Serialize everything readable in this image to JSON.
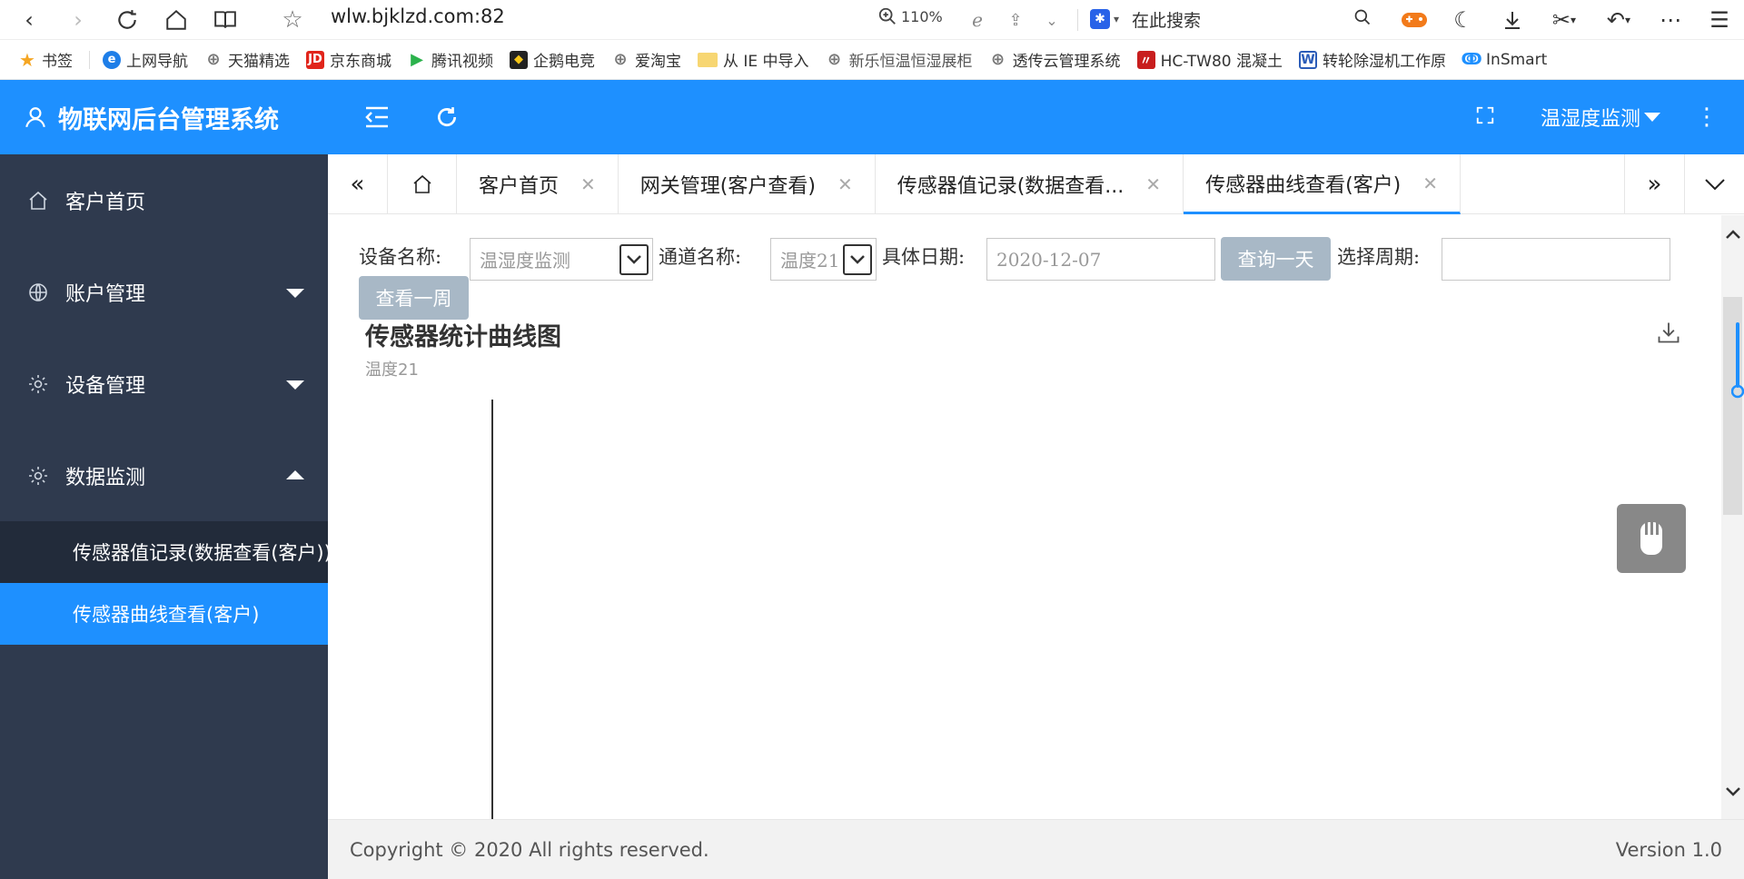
{
  "browser": {
    "url": "wlw.bjklzd.com:82",
    "zoom": "110%",
    "search_placeholder": "在此搜索"
  },
  "bookmarks": [
    {
      "label": "书签",
      "icon": "star-icon"
    },
    {
      "label": "上网导航",
      "icon": "ie-icon"
    },
    {
      "label": "天猫精选",
      "icon": "globe-icon"
    },
    {
      "label": "京东商城",
      "icon": "jd-icon"
    },
    {
      "label": "腾讯视频",
      "icon": "video-icon"
    },
    {
      "label": "企鹅电竞",
      "icon": "penguin-icon"
    },
    {
      "label": "爱淘宝",
      "icon": "globe-icon"
    },
    {
      "label": "从 IE 中导入",
      "icon": "folder-icon"
    },
    {
      "label": "新乐恒温恒湿展柜",
      "icon": "globe-icon"
    },
    {
      "label": "透传云管理系统",
      "icon": "globe-icon"
    },
    {
      "label": "HC-TW80 混凝土",
      "icon": "brand-icon"
    },
    {
      "label": "转轮除湿机工作原",
      "icon": "word-icon"
    },
    {
      "label": "InSmart",
      "icon": "insmart-icon"
    }
  ],
  "header": {
    "brand": "物联网后台管理系统",
    "user_menu": "温湿度监测"
  },
  "sidebar": {
    "items": [
      {
        "label": "客户首页"
      },
      {
        "label": "账户管理"
      },
      {
        "label": "设备管理"
      },
      {
        "label": "数据监测"
      }
    ],
    "sub_items": [
      {
        "label": "传感器值记录(数据查看(客户))"
      },
      {
        "label": "传感器曲线查看(客户)"
      }
    ]
  },
  "tabs": [
    {
      "label": "客户首页"
    },
    {
      "label": "网关管理(客户查看)"
    },
    {
      "label": "传感器值记录(数据查看..."
    },
    {
      "label": "传感器曲线查看(客户)"
    }
  ],
  "form": {
    "device_label": "设备名称:",
    "device_value": "温湿度监测",
    "channel_label": "通道名称:",
    "channel_value": "温度21",
    "date_label": "具体日期:",
    "date_value": "2020-12-07",
    "query_day": "查询一天",
    "period_label": "选择周期:",
    "period_value": "",
    "query_week": "查看一周"
  },
  "chart": {
    "title": "传感器统计曲线图",
    "subtitle": "温度21"
  },
  "footer": {
    "copyright": "Copyright © 2020 All rights reserved.",
    "version": "Version 1.0"
  },
  "colors": {
    "primary": "#1e90ff",
    "sidebar": "#2f3a4e",
    "sidebar_sub": "#222b3a",
    "button_disabled": "#a8b8c6"
  }
}
